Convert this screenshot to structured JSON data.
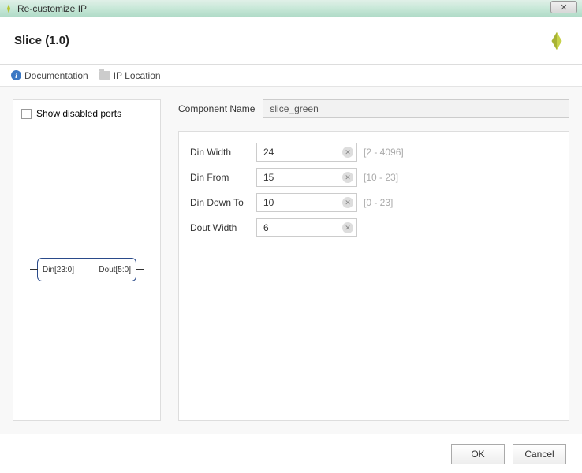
{
  "window": {
    "title": "Re-customize IP"
  },
  "header": {
    "title": "Slice (1.0)"
  },
  "toolbar": {
    "documentation": "Documentation",
    "ip_location": "IP Location"
  },
  "left_panel": {
    "show_disabled_ports": "Show disabled ports",
    "block": {
      "din_port": "Din[23:0]",
      "dout_port": "Dout[5:0]"
    }
  },
  "right_panel": {
    "component_name_label": "Component Name",
    "component_name_value": "slice_green",
    "params": [
      {
        "label": "Din Width",
        "value": "24",
        "hint": "[2 - 4096]"
      },
      {
        "label": "Din From",
        "value": "15",
        "hint": "[10 - 23]"
      },
      {
        "label": "Din Down To",
        "value": "10",
        "hint": "[0 - 23]"
      },
      {
        "label": "Dout Width",
        "value": "6",
        "hint": ""
      }
    ]
  },
  "footer": {
    "ok": "OK",
    "cancel": "Cancel"
  }
}
